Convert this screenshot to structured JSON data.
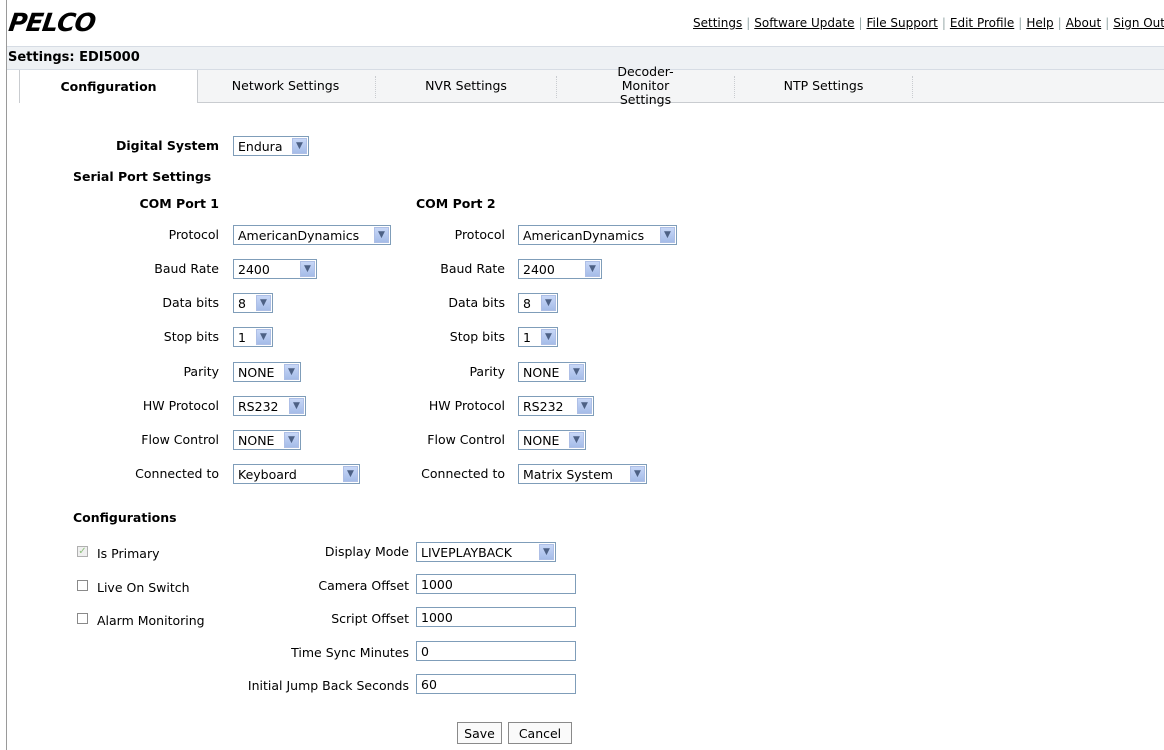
{
  "header": {
    "logo": "PELCO",
    "links": [
      "Settings",
      "Software Update",
      "File Support",
      "Edit Profile",
      "Help",
      "About",
      "Sign Out"
    ]
  },
  "page_title": "Settings: EDI5000",
  "tabs": [
    "Configuration",
    "Network Settings",
    "NVR Settings",
    "Decoder-Monitor Settings",
    "NTP Settings"
  ],
  "digital_system": {
    "label": "Digital System",
    "value": "Endura"
  },
  "serial_port_heading": "Serial Port Settings",
  "com1": {
    "title": "COM Port 1",
    "protocol_label": "Protocol",
    "protocol": "AmericanDynamics",
    "baud_label": "Baud Rate",
    "baud": "2400",
    "databits_label": "Data bits",
    "databits": "8",
    "stopbits_label": "Stop bits",
    "stopbits": "1",
    "parity_label": "Parity",
    "parity": "NONE",
    "hwprotocol_label": "HW Protocol",
    "hwprotocol": "RS232",
    "flow_label": "Flow Control",
    "flow": "NONE",
    "connected_label": "Connected to",
    "connected": "Keyboard"
  },
  "com2": {
    "title": "COM Port 2",
    "protocol_label": "Protocol",
    "protocol": "AmericanDynamics",
    "baud_label": "Baud Rate",
    "baud": "2400",
    "databits_label": "Data bits",
    "databits": "8",
    "stopbits_label": "Stop bits",
    "stopbits": "1",
    "parity_label": "Parity",
    "parity": "NONE",
    "hwprotocol_label": "HW Protocol",
    "hwprotocol": "RS232",
    "flow_label": "Flow Control",
    "flow": "NONE",
    "connected_label": "Connected to",
    "connected": "Matrix System"
  },
  "configurations": {
    "heading": "Configurations",
    "is_primary": "Is Primary",
    "live_on_switch": "Live On Switch",
    "alarm_monitoring": "Alarm Monitoring",
    "display_mode_label": "Display Mode",
    "display_mode": "LIVEPLAYBACK",
    "camera_offset_label": "Camera Offset",
    "camera_offset": "1000",
    "script_offset_label": "Script Offset",
    "script_offset": "1000",
    "time_sync_label": "Time Sync Minutes",
    "time_sync": "0",
    "jump_back_label": "Initial Jump Back Seconds",
    "jump_back": "60"
  },
  "buttons": {
    "save": "Save",
    "cancel": "Cancel"
  }
}
